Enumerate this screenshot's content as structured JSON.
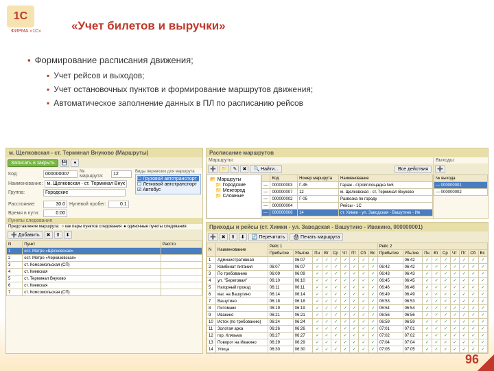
{
  "logo_text": "ФИРМА «1С»",
  "logo_icon": "1С",
  "title": "«Учет билетов и выручки»",
  "bullets": {
    "b1": "Формирование расписания движения;",
    "b2a": "Учет рейсов и выходов;",
    "b2b": "Учет остановочных пунктов и формирование маршрутов движения;",
    "b2c": "Автоматическое заполнение данных в ПЛ по расписанию рейсов"
  },
  "left": {
    "title": "м. Щелковская - ст. Терминал Внуково (Маршруты)",
    "save_close": "Записать и закрыть",
    "code_lbl": "Код:",
    "code": "000000007",
    "routenum_lbl": "№ маршрута:",
    "routenum": "12",
    "name_lbl": "Наименование:",
    "name": "м. Щелковская - ст. Терминал Внуково",
    "group_lbl": "Группа:",
    "group": "Городские",
    "dist_lbl": "Расстояние:",
    "dist": "30.0",
    "nul_lbl": "Нулевой пробег:",
    "nul": "0.1",
    "time_lbl": "Время в пути:",
    "time": "0:00",
    "veh_lbl": "Виды перевозок для маршрута",
    "vehicles": [
      {
        "label": "Грузовой автотранспорт",
        "checked": false,
        "sel": true
      },
      {
        "label": "Легковой автотранспорт",
        "checked": false,
        "sel": false
      },
      {
        "label": "Автобус",
        "checked": true,
        "sel": false
      }
    ],
    "stops_hdr": "Пункты следования",
    "repr_lbl": "Представление маршрута:",
    "repr_opt1": "как пары пунктов следования",
    "repr_opt2": "одиночные пункты следования",
    "add_btn": "Добавить",
    "col_n": "N",
    "col_point": "Пункт",
    "col_dist": "Рассто",
    "stops": [
      {
        "n": 1,
        "name": "ост. Метро «Щёлковская»"
      },
      {
        "n": 2,
        "name": "ост. Метро «Черкизовская»"
      },
      {
        "n": 3,
        "name": "ст. Комсомольская (СП)"
      },
      {
        "n": 4,
        "name": "ст. Киевская"
      },
      {
        "n": 5,
        "name": "ст. Терминал Внуково"
      },
      {
        "n": 6,
        "name": "ст. Киевская"
      },
      {
        "n": 7,
        "name": "ст. Комсомольская (СП)"
      }
    ]
  },
  "routes": {
    "title": "Расписание маршрутов",
    "m_lbl": "Маршруты:",
    "find": "Найти...",
    "all_actions": "Все действия",
    "vyh_lbl": "Выходы:",
    "tree_root": "Маршруты",
    "tree_items": [
      "Городские",
      "Межгород",
      "Сложные"
    ],
    "cols": {
      "code": "Код",
      "num": "Номер маршрута",
      "name": "Наименование"
    },
    "rows": [
      {
        "code": "000000003",
        "num": "Г-45",
        "name": "Гараж - стройплощадка №5"
      },
      {
        "code": "000000007",
        "num": "12",
        "name": "м. Щелковская - ст. Терминал Внуково"
      },
      {
        "code": "000000002",
        "num": "Г-05",
        "name": "Развозка по городу"
      },
      {
        "code": "000000004",
        "num": "",
        "name": "Рейсы - 1С"
      },
      {
        "code": "000000006",
        "num": "14",
        "name": "ст. Химки - ул. Заводская - Вашутино - Ив",
        "sel": true
      }
    ],
    "vyh_col": "№ выхода",
    "vyh_rows": [
      "000000001",
      "000000002"
    ]
  },
  "trips": {
    "title": "Приходы и рейсы (ст. Химки - ул. Заводская - Вашутино - Ивакино, 000000001)",
    "refresh": "Перечитать",
    "print": "Печать маршрута",
    "r1": "Рейс 1",
    "r2": "Рейс 2",
    "cols": [
      "N",
      "Наименование",
      "Прибытие",
      "Убытие",
      "Пн",
      "Вт",
      "Ср",
      "Чт",
      "Пт",
      "Сб",
      "Вс",
      "Прибытие",
      "Убытие",
      "Пн",
      "Вт",
      "Ср",
      "Чт",
      "Пт",
      "Сб",
      "Вс"
    ],
    "rows": [
      {
        "n": 1,
        "name": "Административная",
        "a1": "",
        "u1": "06:07",
        "a2": "",
        "u2": "06:42"
      },
      {
        "n": 2,
        "name": "Комбинат питания",
        "a1": "06:07",
        "u1": "06:07",
        "a2": "06:42",
        "u2": "06:42"
      },
      {
        "n": 3,
        "name": "По требованию",
        "a1": "06:09",
        "u1": "06:09",
        "a2": "06:43",
        "u2": "06:43"
      },
      {
        "n": 4,
        "name": "ул. \"Береговая\"",
        "a1": "06:10",
        "u1": "06:10",
        "a2": "06:45",
        "u2": "06:45"
      },
      {
        "n": 5,
        "name": "Нагорный проезд",
        "a1": "06:11",
        "u1": "06:11",
        "a2": "06:46",
        "u2": "06:46"
      },
      {
        "n": 6,
        "name": "маг. на Вашутино",
        "a1": "06:14",
        "u1": "06:14",
        "a2": "06:49",
        "u2": "06:49"
      },
      {
        "n": 7,
        "name": "Вашутино",
        "a1": "06:18",
        "u1": "06:18",
        "a2": "06:53",
        "u2": "06:53"
      },
      {
        "n": 8,
        "name": "Питомник",
        "a1": "06:19",
        "u1": "06:19",
        "a2": "06:54",
        "u2": "06:54"
      },
      {
        "n": 9,
        "name": "Ивакино",
        "a1": "06:21",
        "u1": "06:21",
        "a2": "06:56",
        "u2": "06:56"
      },
      {
        "n": 10,
        "name": "Исток (по требованию)",
        "a1": "06:24",
        "u1": "06:24",
        "a2": "06:59",
        "u2": "06:59"
      },
      {
        "n": 11,
        "name": "Золотая арка",
        "a1": "06:26",
        "u1": "06:26",
        "a2": "07:01",
        "u2": "07:01"
      },
      {
        "n": 12,
        "name": "гор. Клязьма",
        "a1": "06:27",
        "u1": "06:27",
        "a2": "07:02",
        "u2": "07:02"
      },
      {
        "n": 13,
        "name": "Поворот на Ивакино",
        "a1": "06:29",
        "u1": "06:29",
        "a2": "07:04",
        "u2": "07:04"
      },
      {
        "n": 14,
        "name": "Улица",
        "a1": "06:30",
        "u1": "06:30",
        "a2": "07:05",
        "u2": "07:05"
      }
    ]
  },
  "pagenum": "96"
}
